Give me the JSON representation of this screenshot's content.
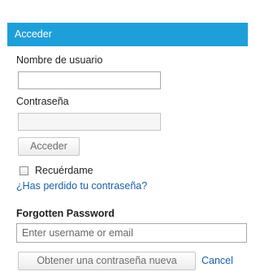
{
  "login": {
    "header": "Acceder",
    "username_label": "Nombre de usuario",
    "username_value": "",
    "password_label": "Contraseña",
    "password_value": "",
    "submit_label": "Acceder",
    "remember_label": "Recuérdame",
    "remember_checked": false,
    "forgot_link": "¿Has perdido tu contraseña?"
  },
  "forgot": {
    "title": "Forgotten Password",
    "input_placeholder": "Enter username or email",
    "input_value": "",
    "submit_label": "Obtener una contraseña nueva",
    "cancel_label": "Cancel"
  },
  "colors": {
    "header_bg": "#1e9fd9",
    "link": "#1a5fa8"
  }
}
